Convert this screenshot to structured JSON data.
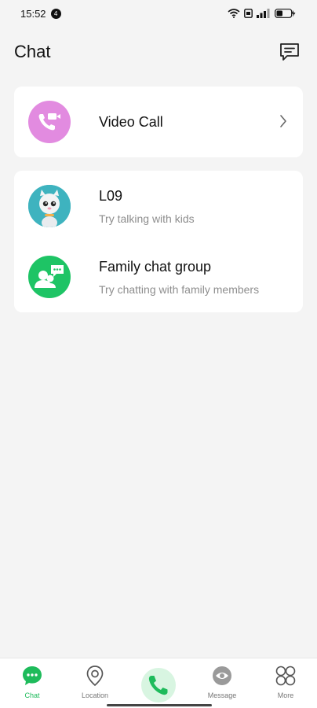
{
  "status": {
    "time": "15:52",
    "notification_badge": "4",
    "battery": "37"
  },
  "header": {
    "title": "Chat",
    "action_icon": "message-square-icon"
  },
  "video_call": {
    "label": "Video Call",
    "icon": "video-call-icon"
  },
  "chats": [
    {
      "title": "L09",
      "subtitle": "Try talking with kids",
      "icon": "kid-avatar"
    },
    {
      "title": "Family chat group",
      "subtitle": "Try chatting with family members",
      "icon": "family-group-icon"
    }
  ],
  "nav": {
    "items": [
      {
        "label": "Chat",
        "icon": "chat-icon",
        "active": true
      },
      {
        "label": "Location",
        "icon": "location-pin-icon",
        "active": false
      },
      {
        "label": "",
        "icon": "phone-icon",
        "active": false
      },
      {
        "label": "Message",
        "icon": "eye-icon",
        "active": false
      },
      {
        "label": "More",
        "icon": "grid-icon",
        "active": false
      }
    ]
  },
  "colors": {
    "accent": "#1ebb5b",
    "video_avatar": "#e28be0",
    "kid_avatar": "#3eb3bf",
    "family_avatar": "#1ec465",
    "background": "#f4f4f4"
  }
}
